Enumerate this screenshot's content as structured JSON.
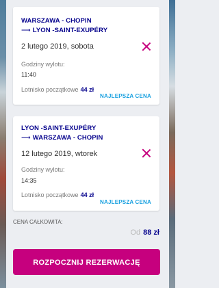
{
  "flights": [
    {
      "from": "WARSZAWA - CHOPIN",
      "arrow": "⟶",
      "to": "LYON -SAINT-EXUPÉRY",
      "date": "2 lutego 2019, sobota",
      "departure_label": "Godziny wylotu:",
      "departure_time": "11:40",
      "airport_label": "Lotnisko początkowe",
      "price": "44 zł",
      "best_price_badge": "NAJLEPSZA CENA",
      "remove_icon": "close-x-icon"
    },
    {
      "from": "LYON -SAINT-EXUPÉRY",
      "arrow": "⟶",
      "to": "WARSZAWA - CHOPIN",
      "date": "12 lutego 2019, wtorek",
      "departure_label": "Godziny wylotu:",
      "departure_time": "14:35",
      "airport_label": "Lotnisko początkowe",
      "price": "44 zł",
      "best_price_badge": "NAJLEPSZA CENA",
      "remove_icon": "close-x-icon"
    }
  ],
  "total": {
    "label": "CENA CAŁKOWITA:",
    "prefix": "Od",
    "amount": "88 zł"
  },
  "cta": {
    "label": "ROZPOCZNIJ REZERWACJĘ"
  },
  "colors": {
    "navy": "#06038d",
    "magenta": "#c6007e",
    "badge_blue": "#1aa1e0",
    "panel_bg": "#eceef2"
  }
}
